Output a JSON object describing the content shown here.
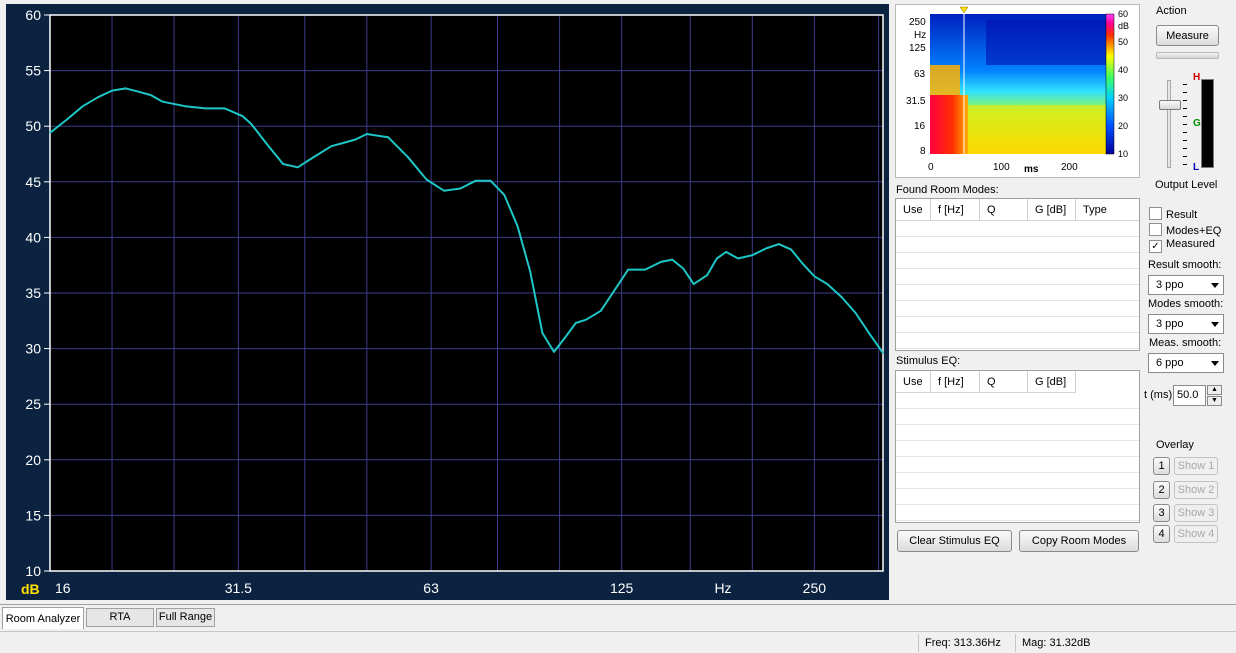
{
  "chart_data": {
    "type": "line",
    "ylabel": "dB",
    "xlabel": "Hz",
    "x_scale": "log",
    "xlim": [
      16,
      320
    ],
    "ylim": [
      10,
      60
    ],
    "y_ticks": [
      60,
      55,
      50,
      45,
      40,
      35,
      30,
      25,
      20,
      15,
      10
    ],
    "x_tick_labels": [
      "16",
      "31.5",
      "63",
      "125",
      "Hz",
      "250"
    ],
    "x_tick_values": [
      16,
      31.5,
      63,
      125,
      180,
      250
    ],
    "x_grid_lines": [
      16,
      20,
      25,
      31.5,
      40,
      50,
      63,
      80,
      100,
      125,
      160,
      200,
      250,
      315
    ],
    "grid": true,
    "series": [
      {
        "color": "#1fc6c6",
        "x": [
          16,
          17,
          18,
          19,
          20,
          21,
          22,
          23,
          24,
          26,
          28,
          30,
          32,
          33,
          35,
          37,
          39,
          41,
          44,
          46,
          48,
          50,
          54,
          58,
          62,
          66,
          70,
          74,
          78,
          82,
          86,
          90,
          94,
          98,
          102,
          106,
          110,
          116,
          122,
          128,
          136,
          144,
          150,
          156,
          162,
          170,
          176,
          182,
          190,
          200,
          210,
          220,
          230,
          240,
          250,
          262,
          276,
          290,
          305,
          320
        ],
        "y": [
          49.4,
          50.6,
          51.8,
          52.6,
          53.2,
          53.4,
          53.1,
          52.8,
          52.2,
          51.8,
          51.6,
          51.6,
          50.9,
          50.2,
          48.3,
          46.6,
          46.3,
          47.1,
          48.2,
          48.5,
          48.8,
          49.3,
          49.0,
          47.2,
          45.2,
          44.2,
          44.4,
          45.1,
          45.1,
          43.8,
          41.0,
          36.9,
          31.4,
          29.7,
          31.0,
          32.3,
          32.6,
          33.4,
          35.3,
          37.1,
          37.1,
          37.8,
          38.0,
          37.2,
          35.8,
          36.6,
          38.1,
          38.7,
          38.1,
          38.4,
          39.0,
          39.4,
          38.9,
          37.6,
          36.5,
          35.8,
          34.6,
          33.2,
          31.3,
          29.6
        ]
      }
    ]
  },
  "spectrogram": {
    "y_labels": [
      "250",
      "Hz",
      "125",
      "63",
      "31.5",
      "16",
      "8"
    ],
    "x_labels": [
      "0",
      "100",
      "ms",
      "200"
    ],
    "scale_labels": [
      "60",
      "dB",
      "50",
      "40",
      "30",
      "20",
      "10"
    ]
  },
  "action": {
    "group_label": "Action",
    "measure_button": "Measure",
    "output_level_label": "Output Level",
    "meter_h": "H",
    "meter_g": "G",
    "meter_l": "L"
  },
  "room_modes": {
    "label": "Found Room Modes:",
    "columns": [
      "Use",
      "f [Hz]",
      "Q",
      "G [dB]",
      "Type"
    ]
  },
  "stimulus_eq": {
    "label": "Stimulus EQ:",
    "columns": [
      "Use",
      "f [Hz]",
      "Q",
      "G [dB]"
    ]
  },
  "options": {
    "result_label": "Result",
    "result_checked": false,
    "modes_eq_label": "Modes+EQ",
    "modes_eq_checked": false,
    "measured_label": "Measured",
    "measured_checked": true,
    "result_smooth_label": "Result smooth:",
    "result_smooth_value": "3 ppo",
    "modes_smooth_label": "Modes smooth:",
    "modes_smooth_value": "3 ppo",
    "meas_smooth_label": "Meas. smooth:",
    "meas_smooth_value": "6 ppo",
    "t_label": "t (ms)",
    "t_value": "50.0"
  },
  "overlay": {
    "label": "Overlay",
    "items": [
      {
        "num": "1",
        "show": "Show 1"
      },
      {
        "num": "2",
        "show": "Show 2"
      },
      {
        "num": "3",
        "show": "Show 3"
      },
      {
        "num": "4",
        "show": "Show 4"
      }
    ]
  },
  "buttons": {
    "clear_stimulus": "Clear Stimulus EQ",
    "copy_modes": "Copy Room Modes"
  },
  "tabs": [
    "Room Analyzer",
    "RTA",
    "Full Range"
  ],
  "status": {
    "freq": "Freq: 313.36Hz",
    "mag": "Mag: 31.32dB"
  }
}
